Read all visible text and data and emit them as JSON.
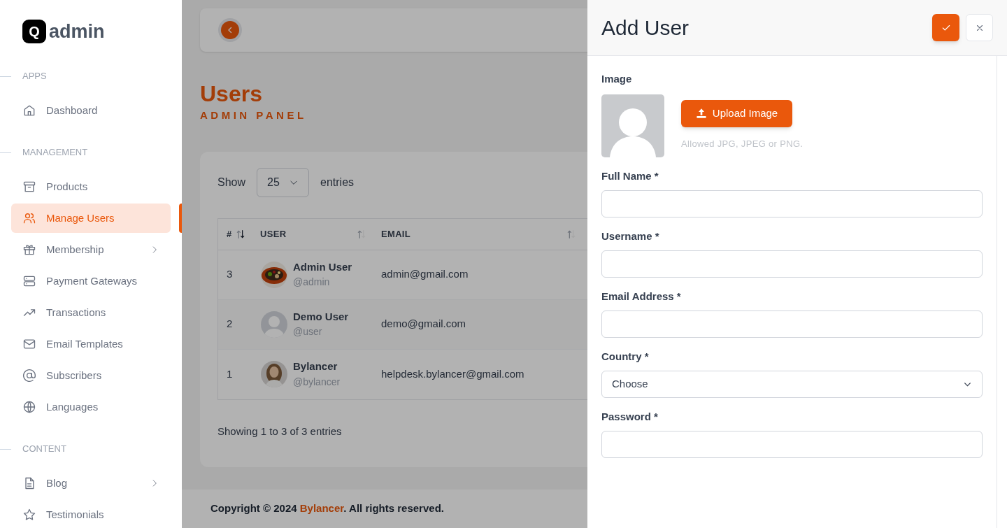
{
  "brand": {
    "mark": "Q",
    "name": "admin"
  },
  "sidebar": {
    "sections": [
      {
        "label": "APPS",
        "items": [
          {
            "label": "Dashboard",
            "selected": false,
            "expandable": false
          }
        ]
      },
      {
        "label": "MANAGEMENT",
        "items": [
          {
            "label": "Products",
            "selected": false,
            "expandable": false
          },
          {
            "label": "Manage Users",
            "selected": true,
            "expandable": false
          },
          {
            "label": "Membership",
            "selected": false,
            "expandable": true
          },
          {
            "label": "Payment Gateways",
            "selected": false,
            "expandable": false
          },
          {
            "label": "Transactions",
            "selected": false,
            "expandable": false
          },
          {
            "label": "Email Templates",
            "selected": false,
            "expandable": false
          },
          {
            "label": "Subscribers",
            "selected": false,
            "expandable": false
          },
          {
            "label": "Languages",
            "selected": false,
            "expandable": false
          }
        ]
      },
      {
        "label": "CONTENT",
        "items": [
          {
            "label": "Blog",
            "selected": false,
            "expandable": true
          },
          {
            "label": "Testimonials",
            "selected": false,
            "expandable": false
          }
        ]
      }
    ]
  },
  "page": {
    "title": "Users",
    "subtitle": "ADMIN PANEL"
  },
  "table": {
    "show_label": "Show",
    "page_size": "25",
    "entries_label": "entries",
    "columns": [
      {
        "label": "#",
        "sorted": true
      },
      {
        "label": "USER",
        "sorted": false
      },
      {
        "label": "EMAIL",
        "sorted": false
      }
    ],
    "rows": [
      {
        "id": "3",
        "name": "Admin User",
        "username": "@admin",
        "email": "admin@gmail.com"
      },
      {
        "id": "2",
        "name": "Demo User",
        "username": "@user",
        "email": "demo@gmail.com",
        "avatar": {
          "kind": "placeholder"
        }
      },
      {
        "id": "1",
        "name": "Bylancer",
        "username": "@bylancer",
        "email": "helpdesk.bylancer@gmail.com"
      }
    ],
    "summary": "Showing 1 to 3 of 3 entries"
  },
  "footer": {
    "prefix": "Copyright © 2024",
    "link": "Bylancer",
    "suffix": ". All rights reserved."
  },
  "drawer": {
    "title": "Add User",
    "image_label": "Image",
    "upload_button": "Upload Image",
    "upload_hint": "Allowed JPG, JPEG or PNG.",
    "fields": [
      {
        "kind": "text",
        "label": "Full Name *"
      },
      {
        "kind": "text",
        "label": "Username *"
      },
      {
        "kind": "text",
        "label": "Email Address *"
      },
      {
        "kind": "select",
        "label": "Country *",
        "value": "Choose"
      },
      {
        "kind": "password",
        "label": "Password *"
      }
    ]
  }
}
